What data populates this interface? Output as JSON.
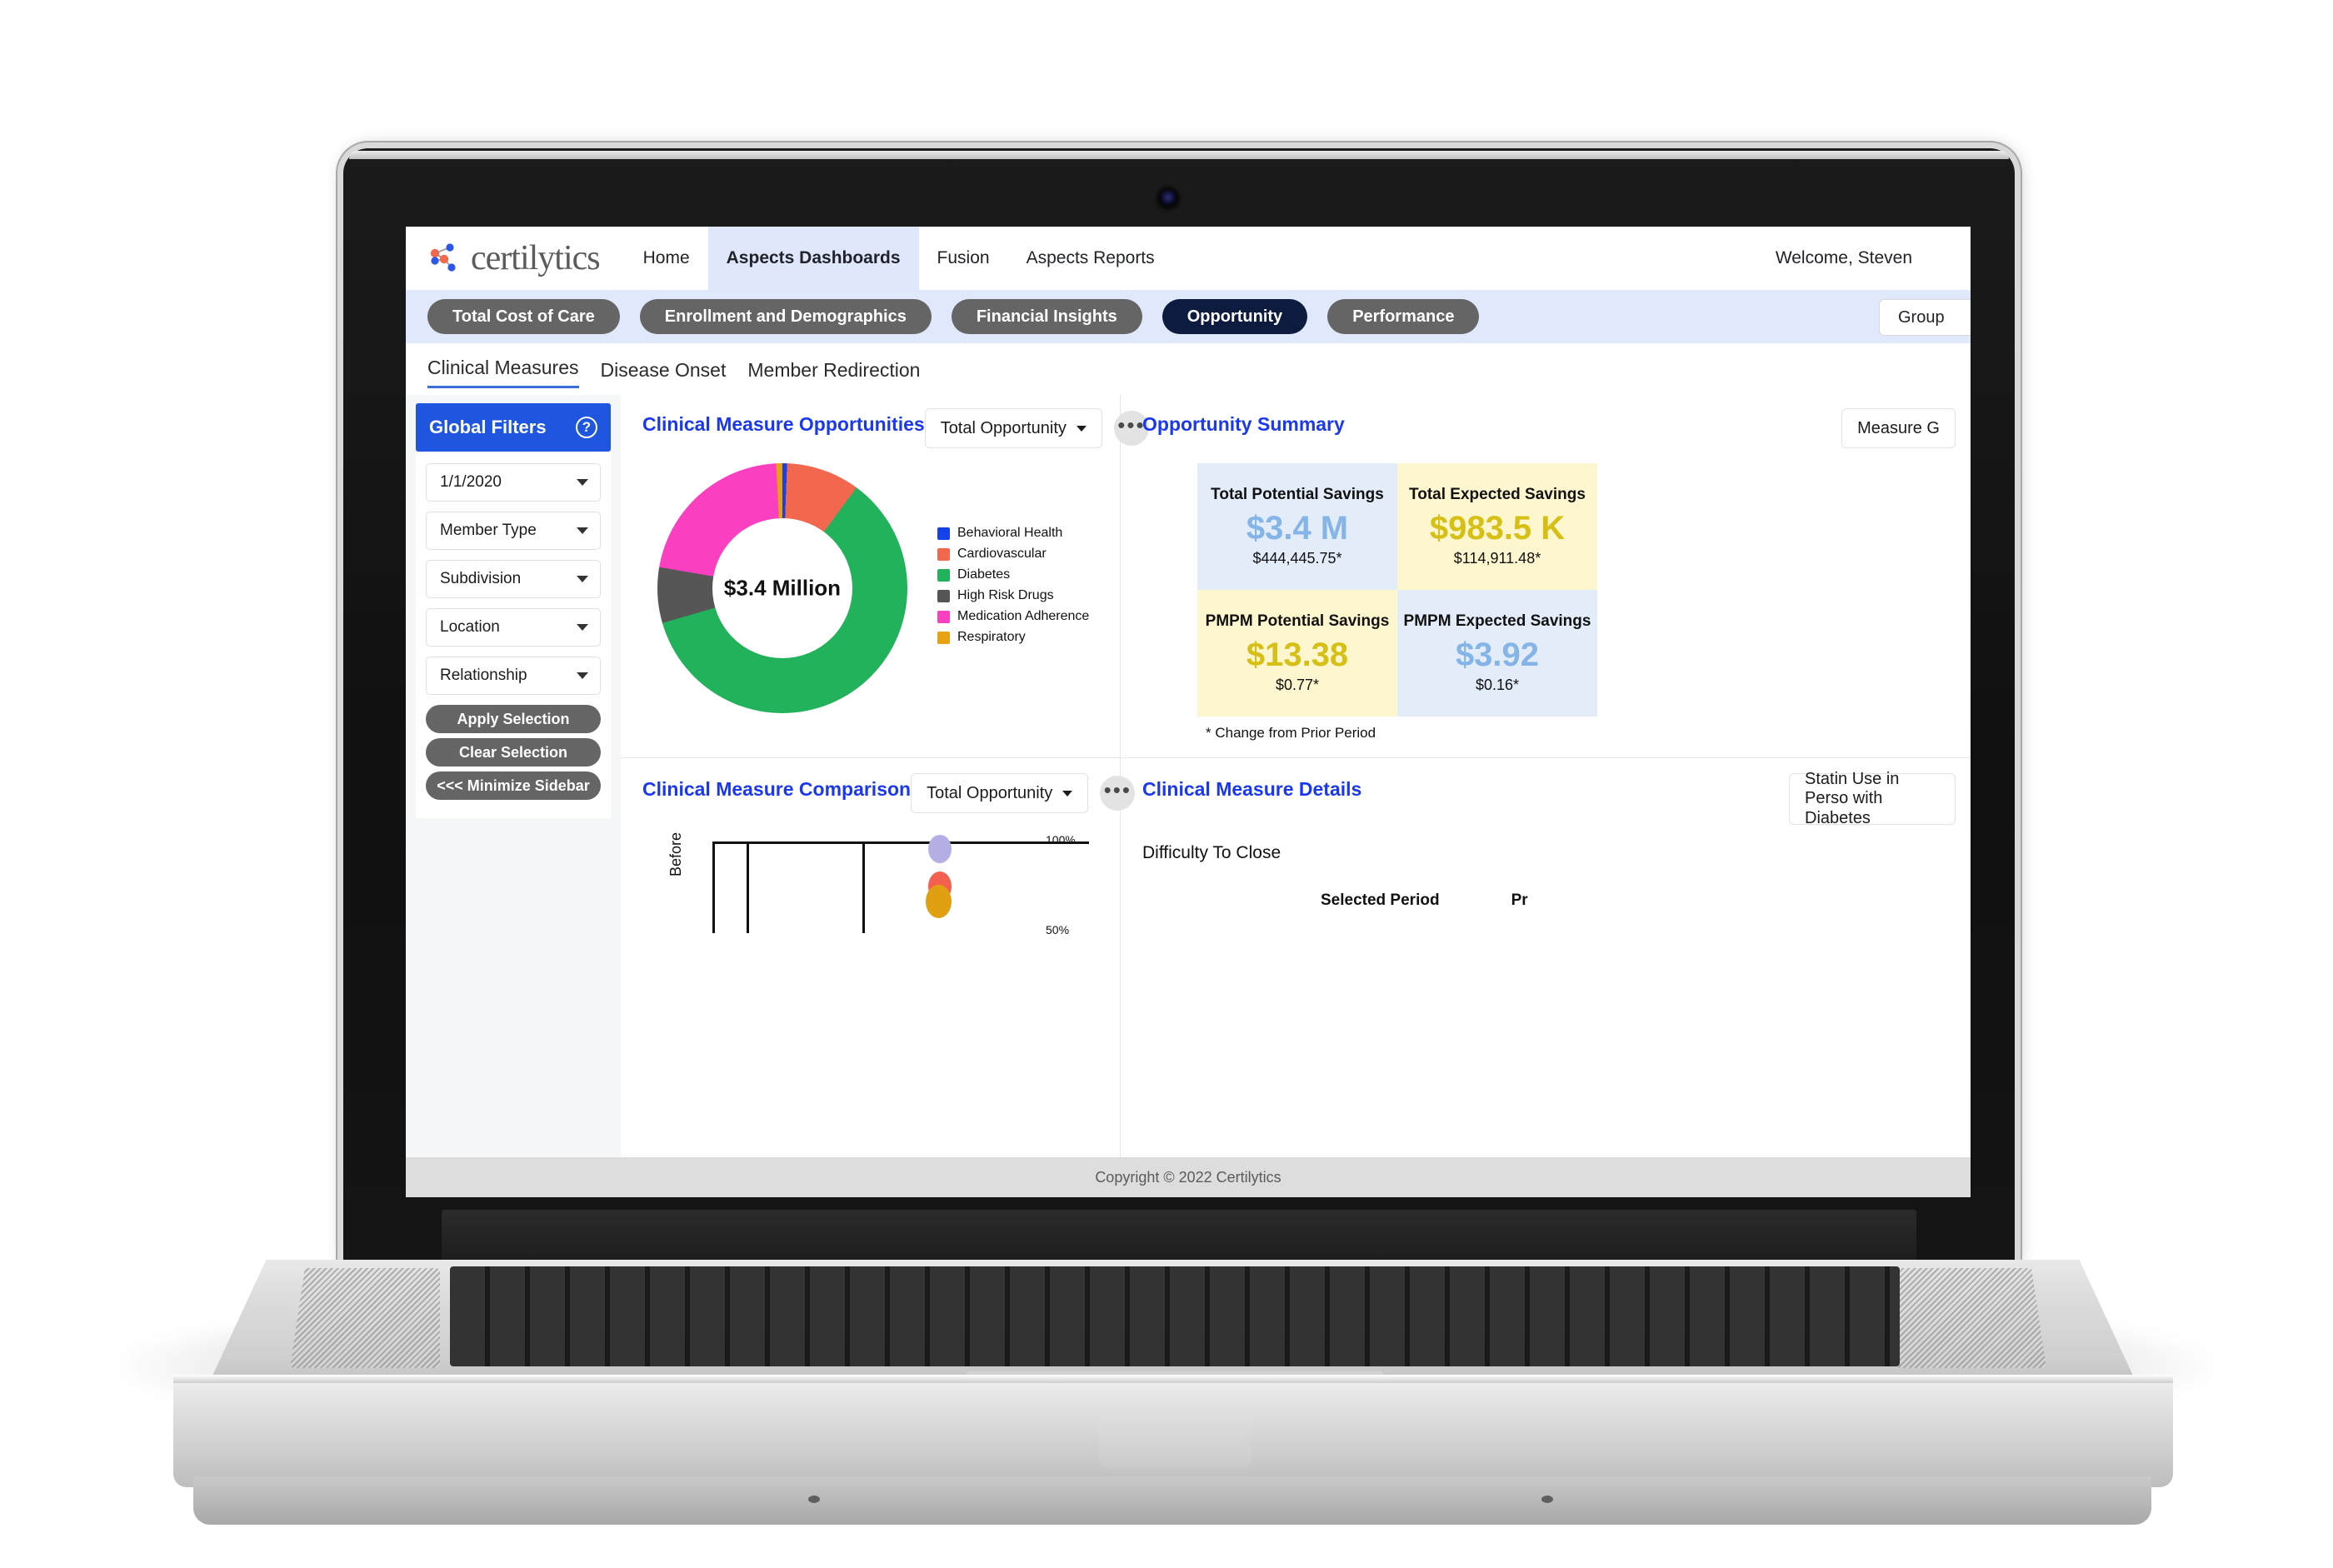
{
  "browser": {
    "header": {
      "brand": "certilytics",
      "nav": [
        {
          "label": "Home",
          "active": false
        },
        {
          "label": "Aspects Dashboards",
          "active": true
        },
        {
          "label": "Fusion",
          "active": false
        },
        {
          "label": "Aspects Reports",
          "active": false
        }
      ],
      "welcome": "Welcome, Steven"
    },
    "pillbar": {
      "pills": [
        {
          "label": "Total Cost of Care",
          "active": false
        },
        {
          "label": "Enrollment and Demographics",
          "active": false
        },
        {
          "label": "Financial Insights",
          "active": false
        },
        {
          "label": "Opportunity",
          "active": true
        },
        {
          "label": "Performance",
          "active": false
        }
      ],
      "group_select": "Group"
    },
    "subtabs": [
      {
        "label": "Clinical Measures",
        "active": true
      },
      {
        "label": "Disease Onset",
        "active": false
      },
      {
        "label": "Member Redirection",
        "active": false
      }
    ],
    "sidebar": {
      "title": "Global Filters",
      "help_icon": "?",
      "filters": [
        {
          "label": "1/1/2020"
        },
        {
          "label": "Member Type"
        },
        {
          "label": "Subdivision"
        },
        {
          "label": "Location"
        },
        {
          "label": "Relationship"
        }
      ],
      "buttons": [
        {
          "label": "Apply Selection"
        },
        {
          "label": "Clear Selection"
        },
        {
          "label": "<<< Minimize Sidebar"
        }
      ]
    },
    "panels": {
      "opportunities": {
        "title": "Clinical Measure Opportunities",
        "dropdown": "Total Opportunity",
        "kebab": "•••",
        "center_label": "$3.4 Million"
      },
      "summary": {
        "title": "Opportunity Summary",
        "dropdown": "Measure G",
        "kpis": [
          {
            "label": "Total Potential Savings",
            "value": "$3.4 M",
            "sub": "$444,445.75*",
            "bg": "blue",
            "value_color": "blue"
          },
          {
            "label": "Total Expected Savings",
            "value": "$983.5 K",
            "sub": "$114,911.48*",
            "bg": "yellow",
            "value_color": "gold"
          },
          {
            "label": "PMPM Potential Savings",
            "value": "$13.38",
            "sub": "$0.77*",
            "bg": "yellow",
            "value_color": "gold"
          },
          {
            "label": "PMPM Expected Savings",
            "value": "$3.92",
            "sub": "$0.16*",
            "bg": "blue",
            "value_color": "blue"
          }
        ],
        "note": "* Change from Prior Period"
      },
      "comparison": {
        "title": "Clinical Measure Comparison",
        "dropdown": "Total Opportunity",
        "kebab": "•••",
        "y_axis_label": "Before",
        "ticks": [
          "100%",
          "50%"
        ]
      },
      "details": {
        "title": "Clinical Measure Details",
        "dropdown": "Statin Use in Perso with Diabetes",
        "row_label": "Difficulty To Close",
        "columns": [
          "Selected Period",
          "Pr"
        ]
      }
    },
    "footer": "Copyright © 2022 Certilytics"
  },
  "chart_data": [
    {
      "type": "pie",
      "title": "Clinical Measure Opportunities",
      "subtitle": "Total Opportunity",
      "center_label": "$3.4 Million",
      "unit": "USD",
      "total": 3400000,
      "legend_position": "right",
      "categories": [
        "Behavioral Health",
        "Cardiovascular",
        "Diabetes",
        "High Risk Drugs",
        "Medication Adherence",
        "Respiratory"
      ],
      "values": [
        0.6,
        9.5,
        60.4,
        7.2,
        21.5,
        0.8
      ],
      "value_unit": "percent",
      "colors": [
        "#1442e8",
        "#f2684f",
        "#22b25c",
        "#565656",
        "#fa3fc0",
        "#e8a211"
      ]
    },
    {
      "type": "scatter",
      "title": "Clinical Measure Comparison",
      "subtitle": "Total Opportunity",
      "ylabel": "Before",
      "ytick_labels": [
        "100%",
        "50%"
      ],
      "ylim": [
        50,
        100
      ],
      "grid": false,
      "points": [
        {
          "x": 0.62,
          "y": 99,
          "color": "#b3aee3",
          "r": 14
        },
        {
          "x": 0.62,
          "y": 80,
          "color": "#f4604f",
          "r": 14
        },
        {
          "x": 0.615,
          "y": 73,
          "color": "#e0a012",
          "r": 15
        }
      ],
      "vlines": [
        0.09,
        0.4
      ]
    }
  ]
}
